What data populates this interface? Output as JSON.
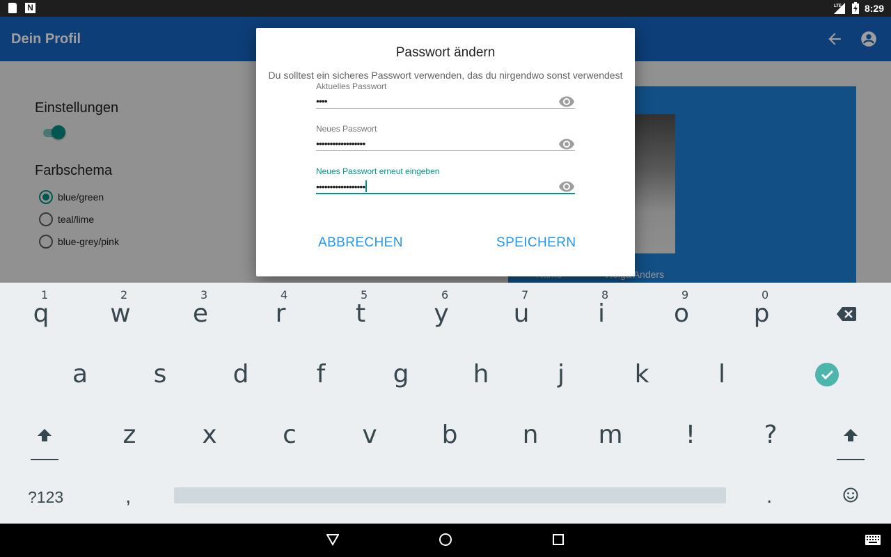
{
  "statusbar": {
    "network": "LTE",
    "time": "8:29"
  },
  "appbar": {
    "title": "Dein Profil"
  },
  "settings": {
    "heading": "Einstellungen",
    "color_scheme_heading": "Farbschema",
    "options": [
      "blue/green",
      "teal/lime",
      "blue-grey/pink"
    ],
    "selected_option": "blue/green"
  },
  "profile": {
    "name_label": "Name",
    "name_value": "Helga Anders"
  },
  "dialog": {
    "title": "Passwort ändern",
    "subtitle": "Du solltest ein sicheres Passwort verwenden, das du nirgendwo sonst verwendest",
    "fields": [
      {
        "label": "Aktuelles Passwort",
        "value": "••••"
      },
      {
        "label": "Neues Passwort",
        "value": "••••••••••••••••••"
      },
      {
        "label": "Neues Passwort erneut eingeben",
        "value": "••••••••••••••••••"
      }
    ],
    "cancel_label": "ABBRECHEN",
    "save_label": "SPEICHERN"
  },
  "keyboard": {
    "row1": [
      "q",
      "w",
      "e",
      "r",
      "t",
      "y",
      "u",
      "i",
      "o",
      "p"
    ],
    "row1_numbers": [
      "1",
      "2",
      "3",
      "4",
      "5",
      "6",
      "7",
      "8",
      "9",
      "0"
    ],
    "row2": [
      "a",
      "s",
      "d",
      "f",
      "g",
      "h",
      "j",
      "k",
      "l"
    ],
    "row3": [
      "z",
      "x",
      "c",
      "v",
      "b",
      "n",
      "m",
      "!",
      "?"
    ],
    "symbols_label": "?123",
    "comma": ",",
    "period": "."
  }
}
